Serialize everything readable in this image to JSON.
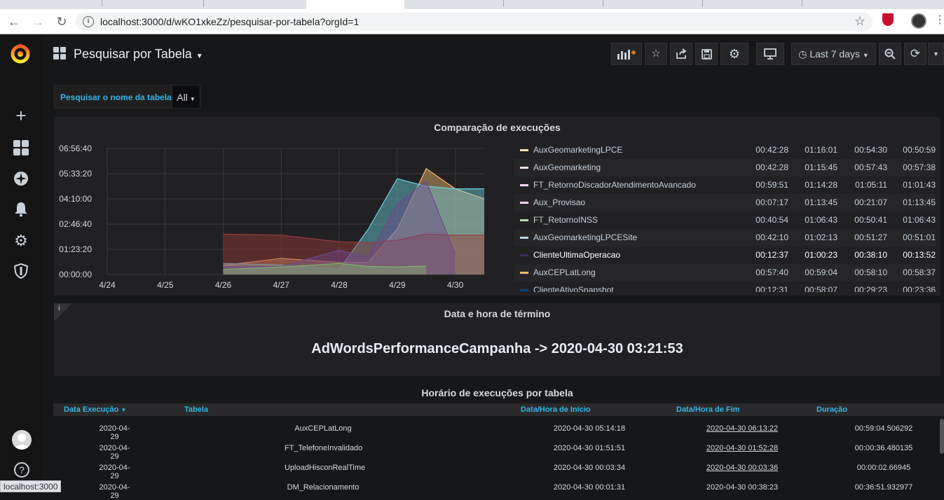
{
  "browser": {
    "url": "localhost:3000/d/wKO1xkeZz/pesquisar-por-tabela?orgId=1",
    "status": "localhost:3000"
  },
  "topnav": {
    "title": "Pesquisar por Tabela",
    "time_range": "Last 7 days"
  },
  "variable": {
    "label": "Pesquisar o nome da tabela",
    "value": "All"
  },
  "graph_panel": {
    "title": "Comparação de execuções",
    "legend": [
      {
        "name": "AuxGeomarketingLPCE",
        "color": "#f9e2b4",
        "v1": "00:42:28",
        "v2": "01:16:01",
        "v3": "00:54:30",
        "v4": "00:50:59"
      },
      {
        "name": "AuxGeomarketing",
        "color": "#fce2de",
        "v1": "00:42:28",
        "v2": "01:15:45",
        "v3": "00:57:43",
        "v4": "00:57:38"
      },
      {
        "name": "FT_RetornoDiscadorAtendimentoAvancado",
        "color": "#f9d9f9",
        "v1": "00:59:51",
        "v2": "01:14:28",
        "v3": "01:05:11",
        "v4": "01:01:43"
      },
      {
        "name": "Aux_Provisao",
        "color": "#f4d5ff",
        "v1": "00:07:17",
        "v2": "01:13:45",
        "v3": "00:21:07",
        "v4": "01:13:45"
      },
      {
        "name": "FT_RetornoINSS",
        "color": "#b7dbab",
        "v1": "00:40:54",
        "v2": "01:06:43",
        "v3": "00:50:41",
        "v4": "01:06:43"
      },
      {
        "name": "AuxGeomarketingLPCESite",
        "color": "#bad9e6",
        "v1": "00:42:10",
        "v2": "01:02:13",
        "v3": "00:51:27",
        "v4": "00:51:01"
      },
      {
        "name": "ClienteUltimaOperacao",
        "color": "#3f2b5b",
        "v1": "00:12:37",
        "v2": "01:00:23",
        "v3": "00:38:10",
        "v4": "00:13:52"
      },
      {
        "name": "AuxCEPLatLong",
        "color": "#f4b86e",
        "v1": "00:57:40",
        "v2": "00:59:04",
        "v3": "00:58:10",
        "v4": "00:58:37"
      },
      {
        "name": "ClienteAtivoSnapshot",
        "color": "#0a437c",
        "v1": "00:12:31",
        "v2": "00:58:07",
        "v3": "00:29:23",
        "v4": "00:23:36"
      }
    ]
  },
  "chart_data": {
    "type": "area",
    "yticks": [
      "06:56:40",
      "05:33:20",
      "04:10:00",
      "02:46:40",
      "01:23:20",
      "00:00:00"
    ],
    "xticks": [
      "4/24",
      "4/25",
      "4/26",
      "4/27",
      "4/28",
      "4/29",
      "4/30"
    ],
    "ylim_seconds": [
      0,
      25000
    ],
    "x": [
      "4/25",
      "4/26",
      "4/27",
      "4/28",
      "4/28.5",
      "4/29",
      "4/29.5",
      "4/30",
      "4/30.5"
    ],
    "series": [
      {
        "name": "AuxCEPLatLong",
        "color": "#f4b86e",
        "values": [
          null,
          1800,
          3200,
          2400,
          2400,
          9000,
          21000,
          17000,
          15000
        ]
      },
      {
        "name": "AuxGeomarketingLPCESite",
        "color": "#6ed0e0",
        "values": [
          null,
          2200,
          1900,
          1000,
          9000,
          19000,
          17500,
          17000,
          17000
        ]
      },
      {
        "name": "FT_RetornoDiscadorAtendimentoAvancado",
        "color": "#9b3a3a",
        "values": [
          null,
          8000,
          7800,
          6500,
          6300,
          6800,
          8000,
          7800,
          7800
        ]
      },
      {
        "name": "ClienteUltimaOperacao",
        "color": "#6d4a8c",
        "values": [
          null,
          1500,
          1600,
          4800,
          3500,
          14000,
          18500,
          4000,
          null
        ]
      },
      {
        "name": "FT_RetornoINSS",
        "color": "#7eb26d",
        "values": [
          null,
          1000,
          1500,
          2200,
          1600,
          1500,
          1700,
          null,
          null
        ]
      }
    ]
  },
  "stat_panel": {
    "title": "Data e hora de término",
    "value": "AdWordsPerformanceCampanha -> 2020-04-30 03:21:53"
  },
  "table_panel": {
    "title": "Horário de execuções por tabela",
    "columns": [
      "Data Execução",
      "Tabela",
      "Data/Hora de Início",
      "Data/Hora de Fim",
      "Duração"
    ],
    "rows": [
      {
        "data": "2020-04-29",
        "tabela": "AuxCEPLatLong",
        "inicio": "2020-04-30 05:14:18",
        "fim": "2020-04-30 06:13:22",
        "duracao": "00:59:04.506292"
      },
      {
        "data": "2020-04-29",
        "tabela": "FT_TelefoneInvalidado",
        "inicio": "2020-04-30 01:51:51",
        "fim": "2020-04-30 01:52:28",
        "duracao": "00:00:36.480135"
      },
      {
        "data": "2020-04-29",
        "tabela": "UploadHisconRealTime",
        "inicio": "2020-04-30 00:03:34",
        "fim": "2020-04-30 00:03:36",
        "duracao": "00:00:02.66945"
      },
      {
        "data": "2020-04-29",
        "tabela": "DM_Relacionamento",
        "inicio": "2020-04-30 00:01:31",
        "fim": "2020-04-30 00:38:23",
        "duracao": "00:36:51.932977"
      }
    ]
  }
}
